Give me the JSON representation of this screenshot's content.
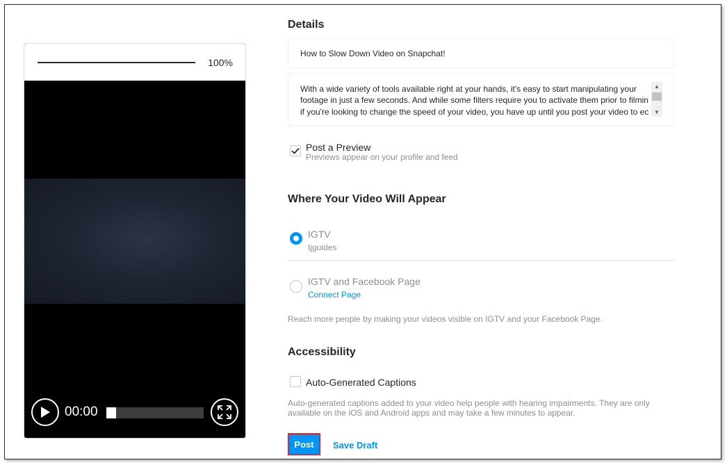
{
  "preview": {
    "upload_percent": "100%",
    "upload_progress": 1.0,
    "time": "00:00",
    "playback_progress": 0.0
  },
  "details": {
    "heading": "Details",
    "title_value": "How to Slow Down Video on Snapchat!",
    "description_lines": [
      "With a wide variety of tools available right at your hands, it's easy to start manipulating your",
      "footage in just a few seconds. And while some filters require you to activate them prior to filmin",
      "if you're looking to change the speed of your video, you have up until you post your video to ec"
    ]
  },
  "post_preview": {
    "label": "Post a Preview",
    "sublabel": "Previews appear on your profile and feed",
    "checked": true
  },
  "where": {
    "heading": "Where Your Video Will Appear",
    "options": [
      {
        "label": "IGTV",
        "sub": "tjguides",
        "selected": true
      },
      {
        "label": "IGTV and Facebook Page",
        "link": "Connect Page",
        "selected": false
      }
    ],
    "note": "Reach more people by making your videos visible on IGTV and your Facebook Page."
  },
  "accessibility": {
    "heading": "Accessibility",
    "captions_label": "Auto-Generated Captions",
    "captions_checked": false,
    "note_lines": [
      "Auto-generated captions added to your video help people with hearing impairments. They are only",
      "available on the iOS and Android apps and may take a few minutes to appear."
    ]
  },
  "actions": {
    "post": "Post",
    "save_draft": "Save Draft"
  },
  "colors": {
    "accent": "#0095f6",
    "highlight_border": "#e0282e"
  }
}
